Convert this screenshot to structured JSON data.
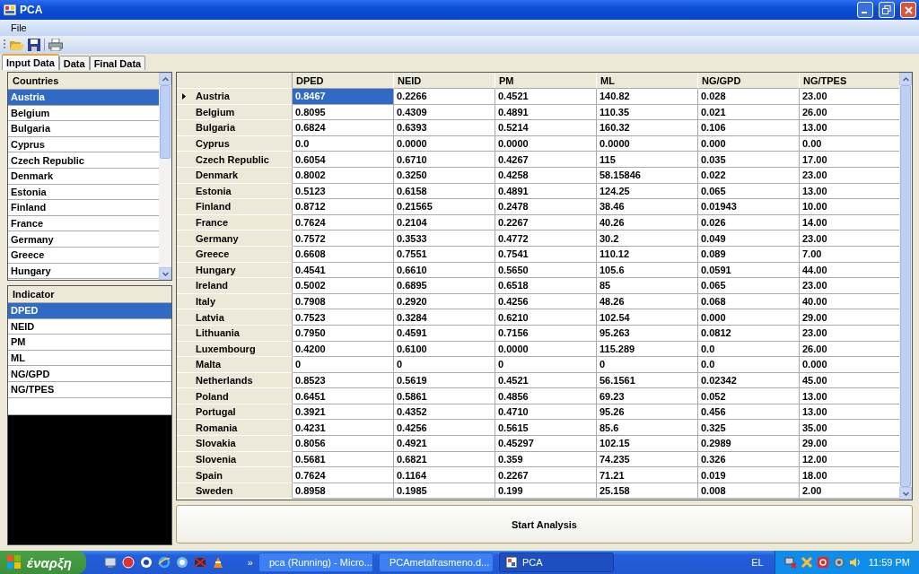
{
  "window": {
    "title": "PCA"
  },
  "menu": [
    "File"
  ],
  "tabs": [
    {
      "label": "Input Data",
      "selected": true
    },
    {
      "label": "Data",
      "selected": false
    },
    {
      "label": "Final Data",
      "selected": false
    }
  ],
  "countries": {
    "header": "Countries",
    "items": [
      {
        "label": "Austria",
        "selected": true
      },
      {
        "label": "Belgium",
        "selected": false
      },
      {
        "label": "Bulgaria",
        "selected": false
      },
      {
        "label": "Cyprus",
        "selected": false
      },
      {
        "label": "Czech Republic",
        "selected": false
      },
      {
        "label": "Denmark",
        "selected": false
      },
      {
        "label": "Estonia",
        "selected": false
      },
      {
        "label": "Finland",
        "selected": false
      },
      {
        "label": "France",
        "selected": false
      },
      {
        "label": "Germany",
        "selected": false
      },
      {
        "label": "Greece",
        "selected": false
      },
      {
        "label": "Hungary",
        "selected": false
      }
    ]
  },
  "indicators": {
    "header": "Indicator",
    "items": [
      {
        "label": "DPED",
        "selected": true
      },
      {
        "label": "NEID",
        "selected": false
      },
      {
        "label": "PM",
        "selected": false
      },
      {
        "label": "ML",
        "selected": false
      },
      {
        "label": "NG/GPD",
        "selected": false
      },
      {
        "label": "NG/TPES",
        "selected": false
      }
    ]
  },
  "table": {
    "columns": [
      "DPED",
      "NEID",
      "PM",
      "ML",
      "NG/GPD",
      "NG/TPES"
    ],
    "rows": [
      {
        "country": "Austria",
        "current": true,
        "cells": [
          {
            "v": "0.8467",
            "selected": true
          },
          {
            "v": "0.2266",
            "selected": false
          },
          {
            "v": "0.4521",
            "selected": false
          },
          {
            "v": "140.82",
            "selected": false
          },
          {
            "v": "0.028",
            "selected": false
          },
          {
            "v": "23.00",
            "selected": false
          }
        ]
      },
      {
        "country": "Belgium",
        "current": false,
        "cells": [
          {
            "v": "0.8095",
            "selected": false
          },
          {
            "v": "0.4309",
            "selected": false
          },
          {
            "v": "0.4891",
            "selected": false
          },
          {
            "v": "110.35",
            "selected": false
          },
          {
            "v": "0.021",
            "selected": false
          },
          {
            "v": "26.00",
            "selected": false
          }
        ]
      },
      {
        "country": "Bulgaria",
        "current": false,
        "cells": [
          {
            "v": "0.6824",
            "selected": false
          },
          {
            "v": "0.6393",
            "selected": false
          },
          {
            "v": "0.5214",
            "selected": false
          },
          {
            "v": "160.32",
            "selected": false
          },
          {
            "v": "0.106",
            "selected": false
          },
          {
            "v": "13.00",
            "selected": false
          }
        ]
      },
      {
        "country": "Cyprus",
        "current": false,
        "cells": [
          {
            "v": "0.0",
            "selected": false
          },
          {
            "v": "0.0000",
            "selected": false
          },
          {
            "v": "0.0000",
            "selected": false
          },
          {
            "v": "0.0000",
            "selected": false
          },
          {
            "v": "0.000",
            "selected": false
          },
          {
            "v": "0.00",
            "selected": false
          }
        ]
      },
      {
        "country": "Czech Republic",
        "current": false,
        "cells": [
          {
            "v": "0.6054",
            "selected": false
          },
          {
            "v": "0.6710",
            "selected": false
          },
          {
            "v": "0.4267",
            "selected": false
          },
          {
            "v": "115",
            "selected": false
          },
          {
            "v": "0.035",
            "selected": false
          },
          {
            "v": "17.00",
            "selected": false
          }
        ]
      },
      {
        "country": "Denmark",
        "current": false,
        "cells": [
          {
            "v": "0.8002",
            "selected": false
          },
          {
            "v": "0.3250",
            "selected": false
          },
          {
            "v": "0.4258",
            "selected": false
          },
          {
            "v": "58.15846",
            "selected": false
          },
          {
            "v": "0.022",
            "selected": false
          },
          {
            "v": "23.00",
            "selected": false
          }
        ]
      },
      {
        "country": "Estonia",
        "current": false,
        "cells": [
          {
            "v": "0.5123",
            "selected": false
          },
          {
            "v": "0.6158",
            "selected": false
          },
          {
            "v": "0.4891",
            "selected": false
          },
          {
            "v": "124.25",
            "selected": false
          },
          {
            "v": "0.065",
            "selected": false
          },
          {
            "v": "13.00",
            "selected": false
          }
        ]
      },
      {
        "country": "Finland",
        "current": false,
        "cells": [
          {
            "v": "0.8712",
            "selected": false
          },
          {
            "v": "0.21565",
            "selected": false
          },
          {
            "v": "0.2478",
            "selected": false
          },
          {
            "v": "38.46",
            "selected": false
          },
          {
            "v": "0.01943",
            "selected": false
          },
          {
            "v": "10.00",
            "selected": false
          }
        ]
      },
      {
        "country": "France",
        "current": false,
        "cells": [
          {
            "v": "0.7624",
            "selected": false
          },
          {
            "v": "0.2104",
            "selected": false
          },
          {
            "v": "0.2267",
            "selected": false
          },
          {
            "v": "40.26",
            "selected": false
          },
          {
            "v": "0.026",
            "selected": false
          },
          {
            "v": "14.00",
            "selected": false
          }
        ]
      },
      {
        "country": "Germany",
        "current": false,
        "cells": [
          {
            "v": "0.7572",
            "selected": false
          },
          {
            "v": "0.3533",
            "selected": false
          },
          {
            "v": "0.4772",
            "selected": false
          },
          {
            "v": "30.2",
            "selected": false
          },
          {
            "v": "0.049",
            "selected": false
          },
          {
            "v": "23.00",
            "selected": false
          }
        ]
      },
      {
        "country": "Greece",
        "current": false,
        "cells": [
          {
            "v": "0.6608",
            "selected": false
          },
          {
            "v": "0.7551",
            "selected": false
          },
          {
            "v": "0.7541",
            "selected": false
          },
          {
            "v": "110.12",
            "selected": false
          },
          {
            "v": "0.089",
            "selected": false
          },
          {
            "v": "7.00",
            "selected": false
          }
        ]
      },
      {
        "country": "Hungary",
        "current": false,
        "cells": [
          {
            "v": "0.4541",
            "selected": false
          },
          {
            "v": "0.6610",
            "selected": false
          },
          {
            "v": "0.5650",
            "selected": false
          },
          {
            "v": "105.6",
            "selected": false
          },
          {
            "v": "0.0591",
            "selected": false
          },
          {
            "v": "44.00",
            "selected": false
          }
        ]
      },
      {
        "country": "Ireland",
        "current": false,
        "cells": [
          {
            "v": "0.5002",
            "selected": false
          },
          {
            "v": "0.6895",
            "selected": false
          },
          {
            "v": "0.6518",
            "selected": false
          },
          {
            "v": "85",
            "selected": false
          },
          {
            "v": "0.065",
            "selected": false
          },
          {
            "v": "23.00",
            "selected": false
          }
        ]
      },
      {
        "country": "Italy",
        "current": false,
        "cells": [
          {
            "v": "0.7908",
            "selected": false
          },
          {
            "v": "0.2920",
            "selected": false
          },
          {
            "v": "0.4256",
            "selected": false
          },
          {
            "v": "48.26",
            "selected": false
          },
          {
            "v": "0.068",
            "selected": false
          },
          {
            "v": "40.00",
            "selected": false
          }
        ]
      },
      {
        "country": "Latvia",
        "current": false,
        "cells": [
          {
            "v": "0.7523",
            "selected": false
          },
          {
            "v": "0.3284",
            "selected": false
          },
          {
            "v": "0.6210",
            "selected": false
          },
          {
            "v": "102.54",
            "selected": false
          },
          {
            "v": "0.000",
            "selected": false
          },
          {
            "v": "29.00",
            "selected": false
          }
        ]
      },
      {
        "country": "Lithuania",
        "current": false,
        "cells": [
          {
            "v": "0.7950",
            "selected": false
          },
          {
            "v": "0.4591",
            "selected": false
          },
          {
            "v": "0.7156",
            "selected": false
          },
          {
            "v": "95.263",
            "selected": false
          },
          {
            "v": "0.0812",
            "selected": false
          },
          {
            "v": "23.00",
            "selected": false
          }
        ]
      },
      {
        "country": "Luxembourg",
        "current": false,
        "cells": [
          {
            "v": "0.4200",
            "selected": false
          },
          {
            "v": "0.6100",
            "selected": false
          },
          {
            "v": "0.0000",
            "selected": false
          },
          {
            "v": "115.289",
            "selected": false
          },
          {
            "v": "0.0",
            "selected": false
          },
          {
            "v": "26.00",
            "selected": false
          }
        ]
      },
      {
        "country": "Malta",
        "current": false,
        "cells": [
          {
            "v": "0",
            "selected": false
          },
          {
            "v": "0",
            "selected": false
          },
          {
            "v": "0",
            "selected": false
          },
          {
            "v": "0",
            "selected": false
          },
          {
            "v": "0.0",
            "selected": false
          },
          {
            "v": "0.000",
            "selected": false
          }
        ]
      },
      {
        "country": "Netherlands",
        "current": false,
        "cells": [
          {
            "v": "0.8523",
            "selected": false
          },
          {
            "v": "0.5619",
            "selected": false
          },
          {
            "v": "0.4521",
            "selected": false
          },
          {
            "v": "56.1561",
            "selected": false
          },
          {
            "v": "0.02342",
            "selected": false
          },
          {
            "v": "45.00",
            "selected": false
          }
        ]
      },
      {
        "country": "Poland",
        "current": false,
        "cells": [
          {
            "v": "0.6451",
            "selected": false
          },
          {
            "v": "0.5861",
            "selected": false
          },
          {
            "v": "0.4856",
            "selected": false
          },
          {
            "v": "69.23",
            "selected": false
          },
          {
            "v": "0.052",
            "selected": false
          },
          {
            "v": "13.00",
            "selected": false
          }
        ]
      },
      {
        "country": "Portugal",
        "current": false,
        "cells": [
          {
            "v": "0.3921",
            "selected": false
          },
          {
            "v": "0.4352",
            "selected": false
          },
          {
            "v": "0.4710",
            "selected": false
          },
          {
            "v": "95.26",
            "selected": false
          },
          {
            "v": "0.456",
            "selected": false
          },
          {
            "v": "13.00",
            "selected": false
          }
        ]
      },
      {
        "country": "Romania",
        "current": false,
        "cells": [
          {
            "v": "0.4231",
            "selected": false
          },
          {
            "v": "0.4256",
            "selected": false
          },
          {
            "v": "0.5615",
            "selected": false
          },
          {
            "v": "85.6",
            "selected": false
          },
          {
            "v": "0.325",
            "selected": false
          },
          {
            "v": "35.00",
            "selected": false
          }
        ]
      },
      {
        "country": "Slovakia",
        "current": false,
        "cells": [
          {
            "v": "0.8056",
            "selected": false
          },
          {
            "v": "0.4921",
            "selected": false
          },
          {
            "v": "0.45297",
            "selected": false
          },
          {
            "v": "102.15",
            "selected": false
          },
          {
            "v": "0.2989",
            "selected": false
          },
          {
            "v": "29.00",
            "selected": false
          }
        ]
      },
      {
        "country": "Slovenia",
        "current": false,
        "cells": [
          {
            "v": "0.5681",
            "selected": false
          },
          {
            "v": "0.6821",
            "selected": false
          },
          {
            "v": "0.359",
            "selected": false
          },
          {
            "v": "74.235",
            "selected": false
          },
          {
            "v": "0.326",
            "selected": false
          },
          {
            "v": "12.00",
            "selected": false
          }
        ]
      },
      {
        "country": "Spain",
        "current": false,
        "cells": [
          {
            "v": "0.7624",
            "selected": false
          },
          {
            "v": "0.1164",
            "selected": false
          },
          {
            "v": "0.2267",
            "selected": false
          },
          {
            "v": "71.21",
            "selected": false
          },
          {
            "v": "0.019",
            "selected": false
          },
          {
            "v": "18.00",
            "selected": false
          }
        ]
      },
      {
        "country": "Sweden",
        "current": false,
        "cells": [
          {
            "v": "0.8958",
            "selected": false
          },
          {
            "v": "0.1985",
            "selected": false
          },
          {
            "v": "0.199",
            "selected": false
          },
          {
            "v": "25.158",
            "selected": false
          },
          {
            "v": "0.008",
            "selected": false
          },
          {
            "v": "2.00",
            "selected": false
          }
        ]
      }
    ]
  },
  "action_button": "Start Analysis",
  "taskbar": {
    "start": "έναρξη",
    "overflow": "»",
    "tasks": [
      {
        "label": "pca (Running) - Micro...",
        "selected": false
      },
      {
        "label": "PCAmetafrasmeno.d...",
        "selected": false
      },
      {
        "label": "PCA",
        "selected": true
      }
    ],
    "language": "EL",
    "clock": "11:59 PM"
  }
}
